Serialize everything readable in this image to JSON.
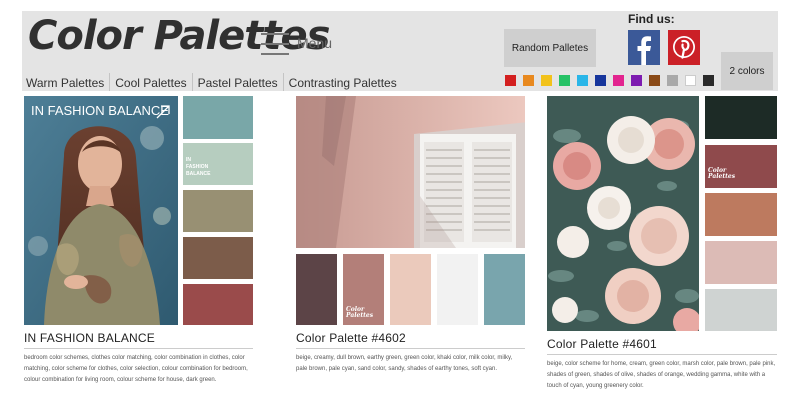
{
  "header": {
    "logo": "Color Palettes",
    "menu_label": "Menu",
    "random_button": "Random Palletes",
    "find_us": "Find us:",
    "colors_button": "2 colors",
    "nav": [
      "Warm Palettes",
      "Cool Palettes",
      "Pastel Palettes",
      "Contrasting Palettes"
    ],
    "color_filters": [
      "#d32020",
      "#e8891f",
      "#f2c21b",
      "#27c266",
      "#2ab6e8",
      "#17369c",
      "#e2258f",
      "#7d1cb0",
      "#8a4a17",
      "#a9a9a9",
      "#ffffff",
      "#2a2a2a"
    ],
    "social": [
      {
        "name": "facebook-icon",
        "color": "#3b5998"
      },
      {
        "name": "pinterest-icon",
        "color": "#cb2027"
      }
    ]
  },
  "cards": [
    {
      "title": "IN FASHION BALANCE",
      "overlay": "IN FASHION BALANCE",
      "swatch_label": "IN FASHION BALANCE",
      "colors": [
        "#79a7a8",
        "#b6cdbf",
        "#989073",
        "#7c5c4a",
        "#9a4b4b"
      ],
      "tags": "bedroom color schemes, clothes color matching, color combination in clothes, color matching, color scheme for clothes, color selection, colour combination for bedroom, colour combination for living room, colour scheme for house, dark green."
    },
    {
      "title": "Color Palette #4602",
      "swatch_label": "Color Palettes",
      "colors": [
        "#5c4447",
        "#b37f79",
        "#ebcabc",
        "#f2f2f2",
        "#79a5ad"
      ],
      "tags": "beige, creamy, dull brown, earthy green, green color, khaki color, milk color, milky, pale brown, pale cyan, sand color, sandy, shades of earthy tones, soft cyan."
    },
    {
      "title": "Color Palette #4601",
      "swatch_label": "Color Palettes",
      "colors": [
        "#1d2b26",
        "#8f4a4c",
        "#bd7a5f",
        "#dcbbb6",
        "#cfd3d2"
      ],
      "tags": "beige, color scheme for home, cream, green color, marsh color, pale brown, pale pink, shades of green, shades of olive, shades of orange, wedding gamma, white with a touch of cyan, young greenery color."
    }
  ]
}
